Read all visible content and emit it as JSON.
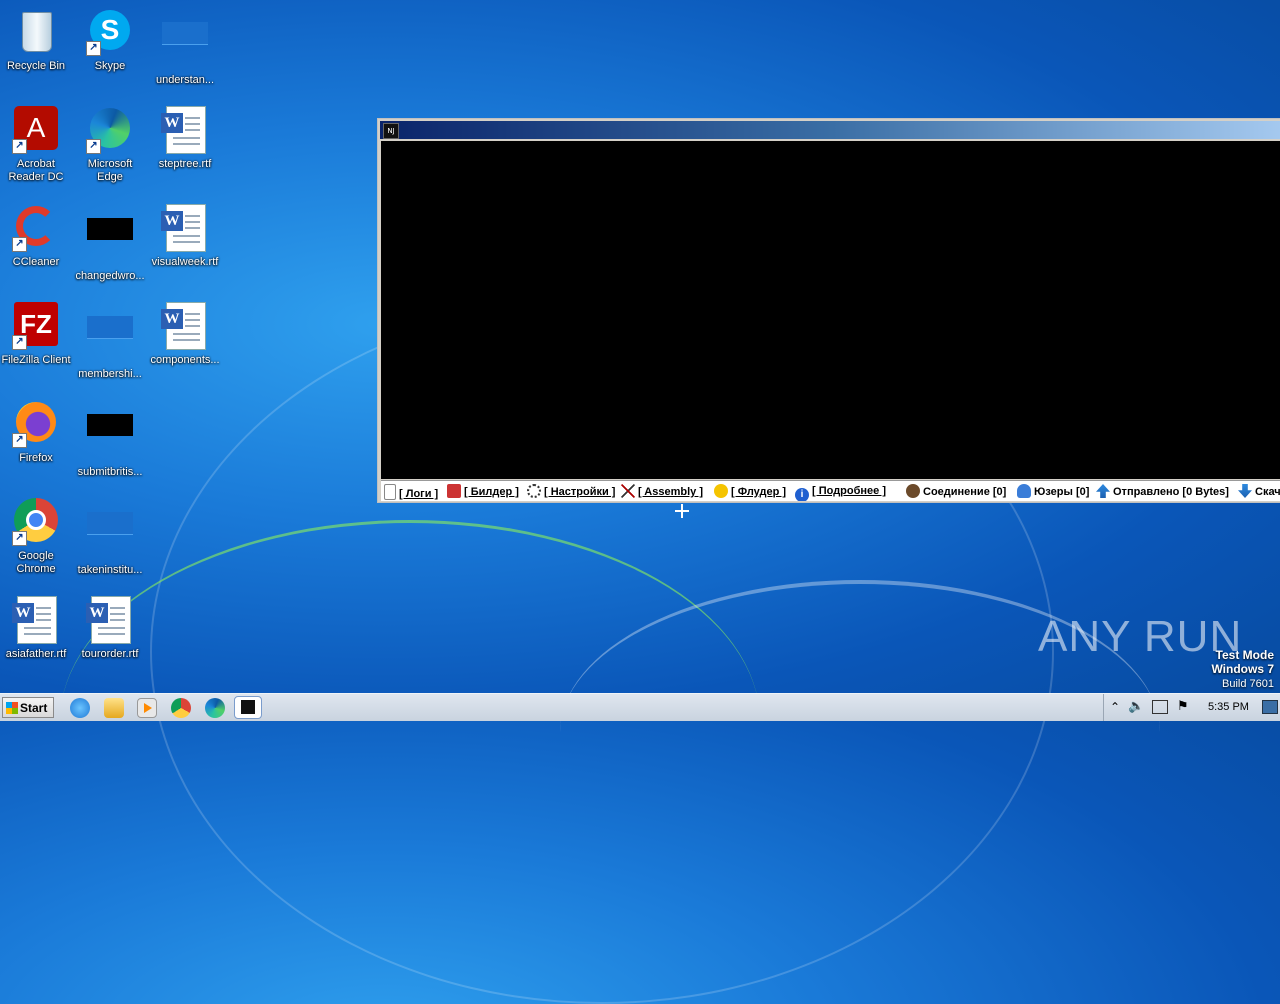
{
  "desktop": {
    "icons": [
      {
        "label": "Recycle Bin"
      },
      {
        "label": "Skype"
      },
      {
        "label": "understan..."
      },
      {
        "label": "Acrobat Reader DC"
      },
      {
        "label": "Microsoft Edge"
      },
      {
        "label": "steptree.rtf"
      },
      {
        "label": "CCleaner"
      },
      {
        "label": "changedwro..."
      },
      {
        "label": "visualweek.rtf"
      },
      {
        "label": "FileZilla Client"
      },
      {
        "label": "membershi..."
      },
      {
        "label": "components..."
      },
      {
        "label": "Firefox"
      },
      {
        "label": "submitbritis..."
      },
      {
        "label": "Google Chrome"
      },
      {
        "label": "takeninstitu..."
      },
      {
        "label": "asiafather.rtf"
      },
      {
        "label": "tourorder.rtf"
      }
    ]
  },
  "window": {
    "app_icon_text": "NJ",
    "status": {
      "logs": "[ Логи ]",
      "builder": "[ Билдер ]",
      "settings": "[ Настройки ]",
      "assembly": "[ Assembly ]",
      "folder": "[ Флудер ]",
      "more": "[ Подробнее ]",
      "connections": "Соединение [0]",
      "users": "Юзеры [0]",
      "sent": "Отправлено [0 Bytes]",
      "received": "Скач"
    }
  },
  "watermark": "ANY RUN",
  "system_text": {
    "mode": "Test Mode",
    "os": "Windows 7",
    "build": "Build 7601"
  },
  "taskbar": {
    "start_label": "Start",
    "clock": "5:35 PM"
  }
}
